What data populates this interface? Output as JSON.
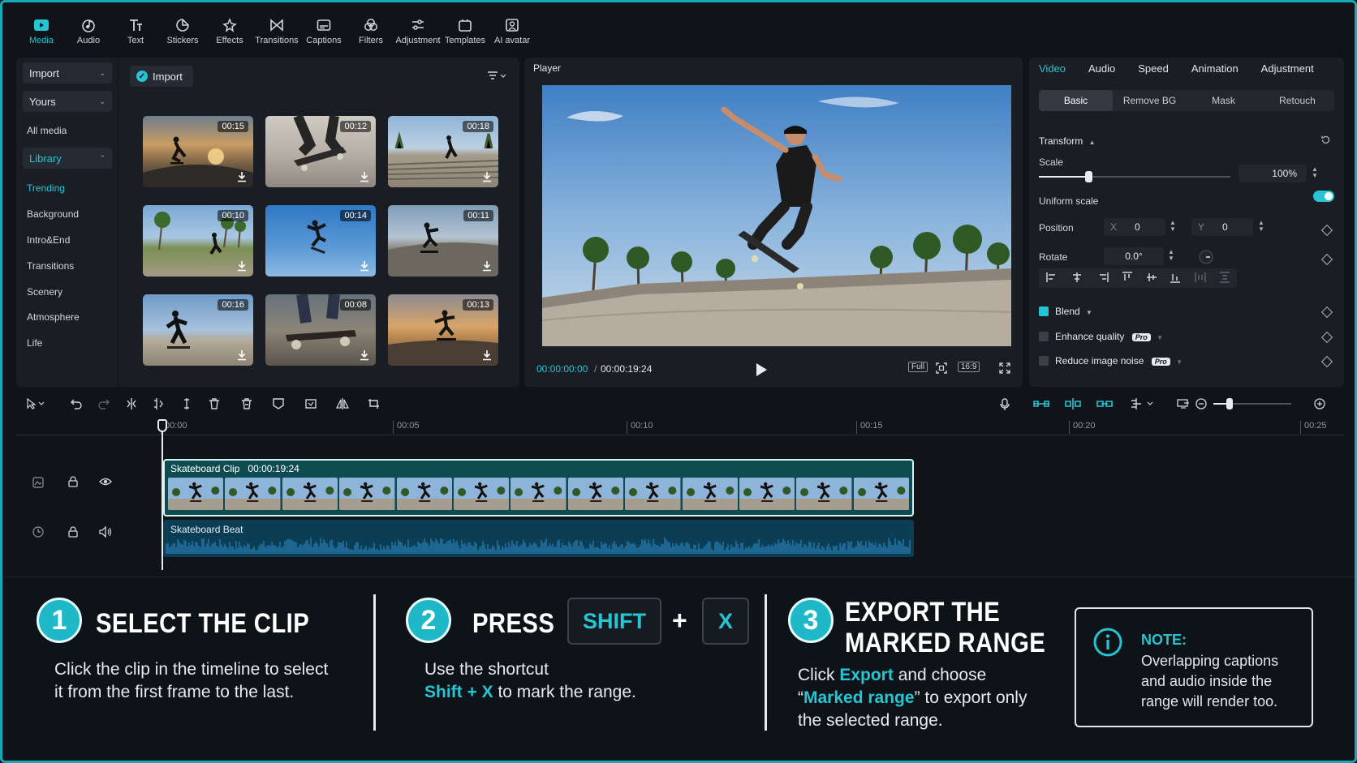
{
  "toolbar": {
    "items": [
      {
        "label": "Media",
        "icon": "media-icon",
        "active": true
      },
      {
        "label": "Audio",
        "icon": "audio-icon"
      },
      {
        "label": "Text",
        "icon": "text-icon"
      },
      {
        "label": "Stickers",
        "icon": "stickers-icon"
      },
      {
        "label": "Effects",
        "icon": "effects-icon"
      },
      {
        "label": "Transitions",
        "icon": "transitions-icon"
      },
      {
        "label": "Captions",
        "icon": "captions-icon"
      },
      {
        "label": "Filters",
        "icon": "filters-icon"
      },
      {
        "label": "Adjustment",
        "icon": "adjustment-icon"
      },
      {
        "label": "Templates",
        "icon": "templates-icon"
      },
      {
        "label": "AI avatar",
        "icon": "ai-avatar-icon"
      }
    ]
  },
  "media": {
    "sidebar": {
      "import": "Import",
      "yours": "Yours",
      "all_media": "All media",
      "library": "Library",
      "items": [
        "Trending",
        "Background",
        "Intro&End",
        "Transitions",
        "Scenery",
        "Atmosphere",
        "Life"
      ]
    },
    "import_button": "Import",
    "thumbnails": [
      {
        "duration": "00:15"
      },
      {
        "duration": "00:12"
      },
      {
        "duration": "00:18"
      },
      {
        "duration": "00:10"
      },
      {
        "duration": "00:14"
      },
      {
        "duration": "00:11"
      },
      {
        "duration": "00:16"
      },
      {
        "duration": "00:08"
      },
      {
        "duration": "00:13"
      }
    ]
  },
  "player": {
    "title": "Player",
    "current_time": "00:00:00:00",
    "separator": "/",
    "total_time": "00:00:19:24",
    "full_label": "Full",
    "ratio_label": "16:9"
  },
  "inspector": {
    "tabs": [
      "Video",
      "Audio",
      "Speed",
      "Animation",
      "Adjustment"
    ],
    "subtabs": [
      "Basic",
      "Remove BG",
      "Mask",
      "Retouch"
    ],
    "transform": "Transform",
    "scale_label": "Scale",
    "scale_value": "100%",
    "scale_fraction": 1.0,
    "uniform_scale": "Uniform scale",
    "position_label": "Position",
    "pos_x_label": "X",
    "pos_x": "0",
    "pos_y_label": "Y",
    "pos_y": "0",
    "rotate_label": "Rotate",
    "rotate_value": "0.0°",
    "blend": "Blend",
    "enhance_quality": "Enhance quality",
    "reduce_noise": "Reduce image noise",
    "pro_badge": "Pro"
  },
  "timeline": {
    "ruler": [
      "00:00",
      "00:05",
      "00:10",
      "00:15",
      "00:20",
      "00:25"
    ],
    "video_clip_name": "Skateboard Clip",
    "video_clip_duration": "00:00:19:24",
    "audio_clip_name": "Skateboard Beat"
  },
  "instructions": {
    "step1": {
      "number": "1",
      "title": "SELECT THE CLIP",
      "body_line1": "Click the clip in the timeline to select",
      "body_line2": "it from the first frame to the last."
    },
    "step2": {
      "number": "2",
      "title": "PRESS",
      "key1": "SHIFT",
      "plus": "+",
      "key2": "X",
      "body_line1": "Use the shortcut",
      "shortcut": "Shift + X",
      "body_line2_rest": " to mark the range."
    },
    "step3": {
      "number": "3",
      "title_line1": "EXPORT THE",
      "title_line2": "MARKED RANGE",
      "body_click": "Click ",
      "export": "Export",
      "body_choose": " and choose",
      "quote_open": "“",
      "marked_range": "Marked range",
      "quote_close_rest": "” to export only",
      "body_line3": "the selected range."
    },
    "note": {
      "title": "NOTE:",
      "text": "Overlapping captions and audio inside the range will render too."
    }
  },
  "colors": {
    "accent": "#27c4d4",
    "frame_border": "#17a9b6",
    "panel": "#1a1e24",
    "background": "#101318"
  }
}
